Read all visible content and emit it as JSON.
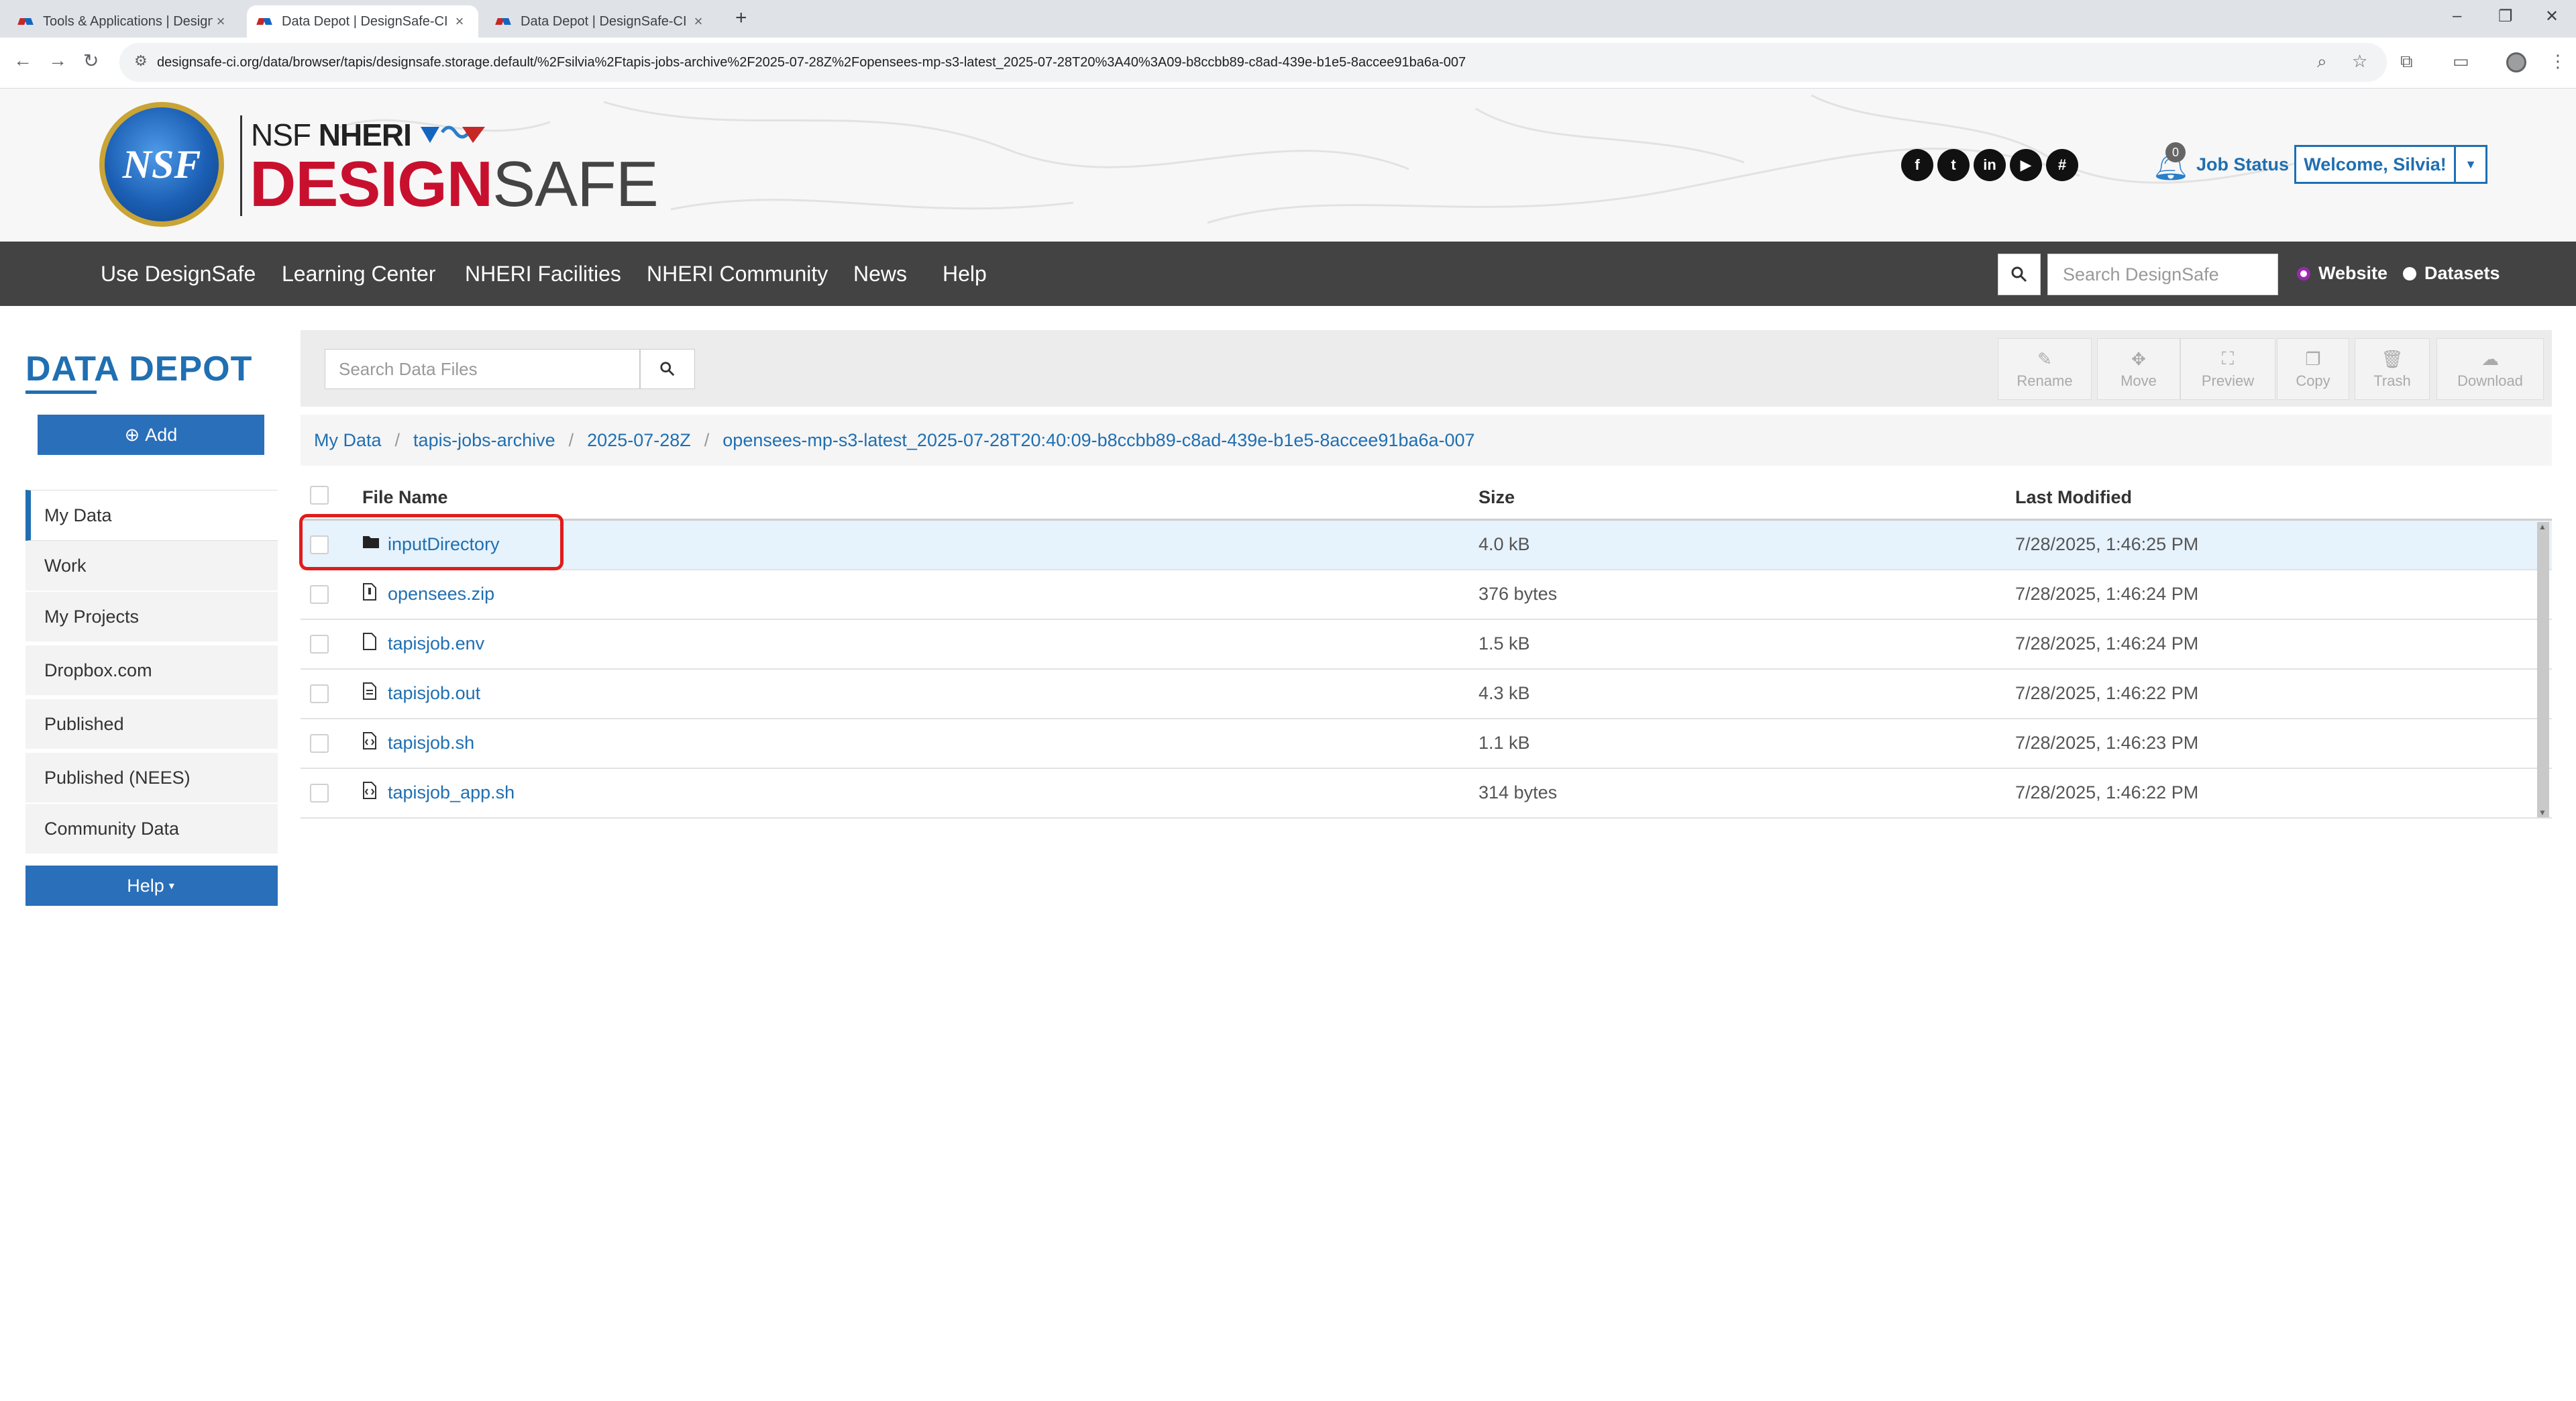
{
  "browser": {
    "tabs": [
      {
        "title": "Tools & Applications | DesignSafe"
      },
      {
        "title": "Data Depot | DesignSafe-CI"
      },
      {
        "title": "Data Depot | DesignSafe-CI"
      }
    ],
    "url": "designsafe-ci.org/data/browser/tapis/designsafe.storage.default/%2Fsilvia%2Ftapis-jobs-archive%2F2025-07-28Z%2Fopensees-mp-s3-latest_2025-07-28T20%3A40%3A09-b8ccbb89-c8ad-439e-b1e5-8accee91ba6a-007"
  },
  "header": {
    "brand_nsf": "NSF",
    "brand_nheri": "NHERI",
    "brand_design": "DESIGN",
    "brand_safe": "SAFE",
    "logo_text": "NSF",
    "social_icons": [
      "facebook-icon",
      "twitter-icon",
      "linkedin-icon",
      "youtube-icon",
      "slack-icon"
    ],
    "notification_count": "0",
    "job_status": "Job Status",
    "welcome": "Welcome, Silvia!"
  },
  "nav": {
    "items": [
      "Use DesignSafe",
      "Learning Center",
      "NHERI Facilities",
      "NHERI Community",
      "News",
      "Help"
    ],
    "search_placeholder": "Search DesignSafe",
    "radio_website": "Website",
    "radio_datasets": "Datasets"
  },
  "sidebar": {
    "title": "DATA DEPOT",
    "add_label": "Add",
    "items": [
      "My Data",
      "Work",
      "My Projects",
      "Dropbox.com",
      "Published",
      "Published (NEES)",
      "Community Data"
    ],
    "help_label": "Help"
  },
  "toolbar": {
    "search_placeholder": "Search Data Files",
    "actions": [
      "Rename",
      "Move",
      "Preview",
      "Copy",
      "Trash",
      "Download"
    ]
  },
  "breadcrumb": [
    "My Data",
    "tapis-jobs-archive",
    "2025-07-28Z",
    "opensees-mp-s3-latest_2025-07-28T20:40:09-b8ccbb89-c8ad-439e-b1e5-8accee91ba6a-007"
  ],
  "table": {
    "headers": {
      "name": "File Name",
      "size": "Size",
      "modified": "Last Modified"
    },
    "rows": [
      {
        "name": "inputDirectory",
        "size": "4.0 kB",
        "modified": "7/28/2025, 1:46:25 PM",
        "icon": "folder-icon"
      },
      {
        "name": "opensees.zip",
        "size": "376 bytes",
        "modified": "7/28/2025, 1:46:24 PM",
        "icon": "zip-file-icon"
      },
      {
        "name": "tapisjob.env",
        "size": "1.5 kB",
        "modified": "7/28/2025, 1:46:24 PM",
        "icon": "file-icon"
      },
      {
        "name": "tapisjob.out",
        "size": "4.3 kB",
        "modified": "7/28/2025, 1:46:22 PM",
        "icon": "text-file-icon"
      },
      {
        "name": "tapisjob.sh",
        "size": "1.1 kB",
        "modified": "7/28/2025, 1:46:23 PM",
        "icon": "code-file-icon"
      },
      {
        "name": "tapisjob_app.sh",
        "size": "314 bytes",
        "modified": "7/28/2025, 1:46:22 PM",
        "icon": "code-file-icon"
      }
    ]
  },
  "colors": {
    "accent": "#1f6fb2",
    "nav_bg": "#434343",
    "brand_red": "#c8102e",
    "highlight": "#e11b1b"
  }
}
